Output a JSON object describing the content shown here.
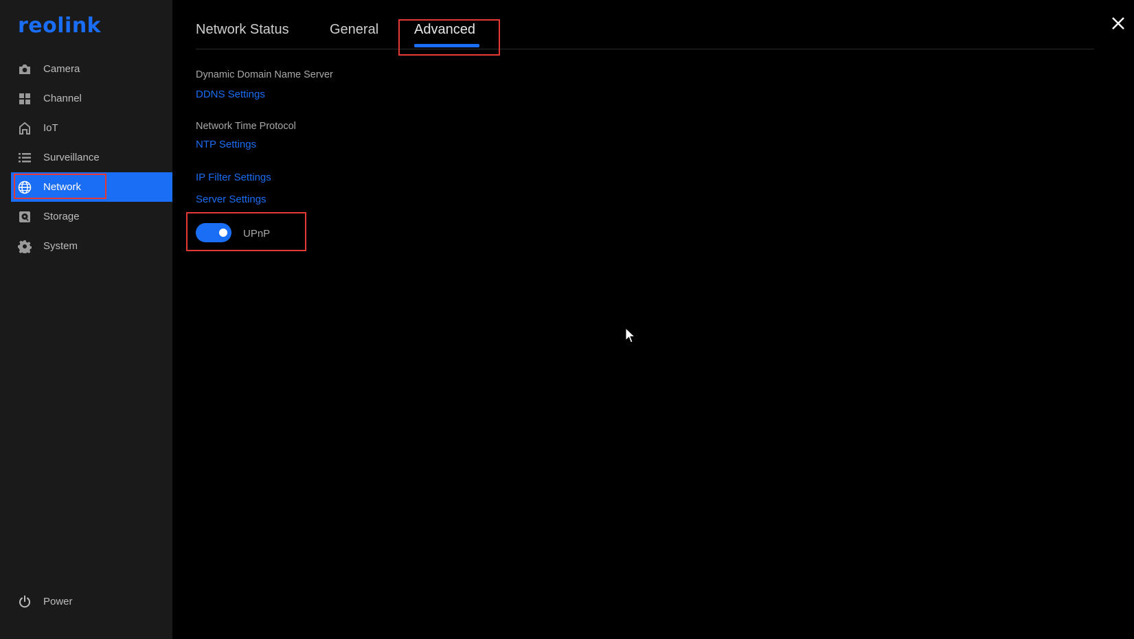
{
  "brand": {
    "logo_text": "reolink",
    "accent": "#1a6df5"
  },
  "sidebar": {
    "items": [
      {
        "label": "Camera",
        "icon": "camera-icon"
      },
      {
        "label": "Channel",
        "icon": "grid-icon"
      },
      {
        "label": "IoT",
        "icon": "home-icon"
      },
      {
        "label": "Surveillance",
        "icon": "list-icon"
      },
      {
        "label": "Network",
        "icon": "globe-icon",
        "active": true
      },
      {
        "label": "Storage",
        "icon": "storage-icon"
      },
      {
        "label": "System",
        "icon": "gear-icon"
      }
    ],
    "power_label": "Power"
  },
  "tabs": [
    {
      "label": "Network Status"
    },
    {
      "label": "General"
    },
    {
      "label": "Advanced",
      "active": true
    }
  ],
  "advanced": {
    "ddns_section": "Dynamic Domain Name Server",
    "ddns_link": "DDNS Settings",
    "ntp_section": "Network Time Protocol",
    "ntp_link": "NTP Settings",
    "ip_filter_link": "IP Filter Settings",
    "server_link": "Server Settings",
    "upnp_label": "UPnP",
    "upnp_enabled": true
  },
  "colors": {
    "highlight_outline": "#e53935",
    "sidebar_bg": "#1a1a1a",
    "main_bg": "#000000"
  }
}
